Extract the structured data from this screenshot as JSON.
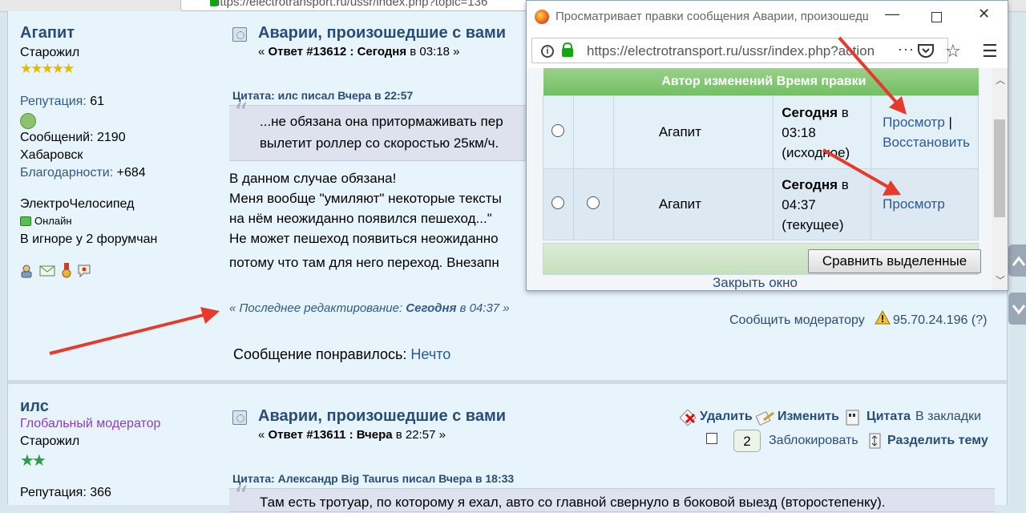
{
  "browser": {
    "url": "https://electrotransport.ru/ussr/index.php?topic=136",
    "popup": {
      "title": "Просматривает правки сообщения Аварии, произошедшие с вами",
      "url": "https://electrotransport.ru/ussr/index.php?action",
      "table": {
        "headers": [
          "",
          "",
          "Автор изменений",
          "Время правки",
          ""
        ],
        "rows": [
          {
            "author": "Агапит",
            "time_bold": "Сегодня",
            "time_rest": " в 03:18 (исходное)",
            "actions": [
              "Просмотр",
              "Восстановить"
            ],
            "sep": " | "
          },
          {
            "author": "Агапит",
            "time_bold": "Сегодня",
            "time_rest": " в 04:37 (текущее)",
            "actions": [
              "Просмотр"
            ]
          }
        ]
      },
      "compare_button": "Сравнить выделенные",
      "close_link": "Закрыть окно"
    }
  },
  "post1": {
    "user": "Агапит",
    "group": "Старожил",
    "stars": "★★★★★",
    "rep_label": "Репутация:",
    "rep_value": " 61",
    "msgs": "Сообщений: 2190",
    "city": "Хабаровск",
    "thanks_label": "Благодарности:",
    "thanks_value": " +684",
    "vehicle": "ЭлектроЧелосипед",
    "online": "Онлайн",
    "ignore": "В игноре у 2 форумчан",
    "title": "Аварии, произошедшие с вами",
    "sub_pre": "« ",
    "sub_reply": "Ответ #13612 : Сегодня",
    "sub_time": " в 03:18 »",
    "quote_head": "Цитата: илс писал Вчера в 22:57",
    "quote_l1": "...не обязана она притормаживать пер",
    "quote_l2": "вылетит роллер со скоростью 25км/ч.",
    "body_l1": "В данном случае обязана!",
    "body_l2": "Меня вообще \"умиляют\" некоторые тексты",
    "body_l3": "на нём неожиданно появился пешеход...\"",
    "body_l4": "Не может пешеход появиться неожиданно",
    "body_l5": "потому что там для него переход. Внезапн",
    "edit_pre": "« Последнее редактирование: ",
    "edit_bold": "Сегодня",
    "edit_post": " в 04:37 »",
    "report": "Сообщить модератору",
    "ip": "95.70.24.196 (?)",
    "liked_label": "Сообщение понравилось:",
    "liked_user": "Нечто"
  },
  "post2": {
    "user": "илс",
    "group1": "Глобальный модератор",
    "group2": "Старожил",
    "stars": "★★",
    "rep": "Репутация: 366",
    "title": "Аварии, произошедшие с вами",
    "sub_pre": "« ",
    "sub_reply": "Ответ #13611 : Вчера",
    "sub_time": " в 22:57 »",
    "delete": "Удалить",
    "edit": "Изменить",
    "quote": "Цитата",
    "bookmark": "В закладки",
    "count": "2",
    "lock": "Заблокировать",
    "split": "Разделить тему",
    "quote_head": "Цитата: Александр Big Taurus писал Вчера в 18:33",
    "quote_l1": "Там есть тротуар, по которому я ехал, авто со главной свернуло в боковой выезд (второстепенку)."
  },
  "colors": {
    "accent": "#264e78",
    "arrow": "#e53a2c",
    "header_green": "#73bf63"
  }
}
